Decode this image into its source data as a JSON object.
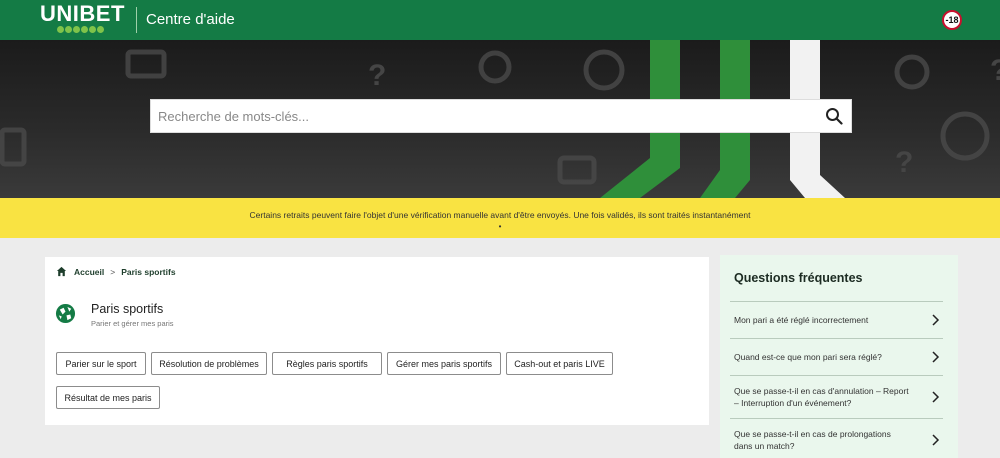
{
  "header": {
    "logo_text": "UNIBET",
    "site_title": "Centre d'aide",
    "age_badge": "-18",
    "brand_color": "#147b45"
  },
  "search": {
    "placeholder": "Recherche de mots-clés...",
    "icon": "search-icon"
  },
  "banner": {
    "message": "Certains retraits peuvent faire l'objet d'une vérification manuelle avant d'être envoyés. Une fois validés, ils sont traités instantanément",
    "dot": "•",
    "color": "#f9e342"
  },
  "breadcrumb": {
    "home_label": "Accueil",
    "separator": ">",
    "current": "Paris sportifs"
  },
  "category": {
    "title": "Paris sportifs",
    "subtitle": "Parier et gérer mes paris",
    "icon": "sports-ball-icon"
  },
  "topics": [
    "Parier sur le sport",
    "Résolution de problèmes",
    "Règles paris sportifs",
    "Gérer mes paris sportifs",
    "Cash-out et paris LIVE",
    "Résultat de mes paris"
  ],
  "faq": {
    "title": "Questions fréquentes",
    "items": [
      "Mon pari a été réglé incorrectement",
      "Quand est-ce que mon pari sera réglé?",
      "Que se passe-t-il en cas d'annulation – Report – Interruption d'un événement?",
      "Que se passe-t-il en cas de prolongations dans un match?"
    ]
  }
}
